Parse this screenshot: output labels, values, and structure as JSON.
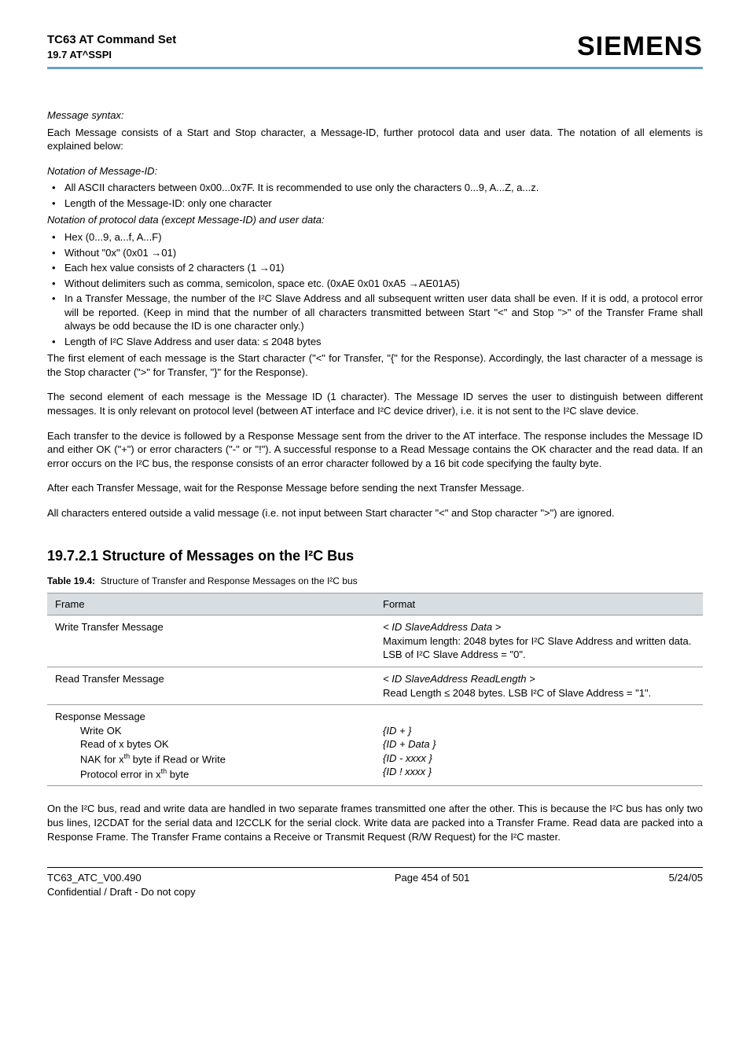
{
  "header": {
    "title": "TC63 AT Command Set",
    "sub": "19.7 AT^SSPI",
    "brand": "SIEMENS"
  },
  "intro": {
    "msgSyntaxLabel": "Message syntax:",
    "msgSyntaxText": "Each Message consists of a Start and Stop character, a Message-ID, further protocol data and user data. The notation of all elements is explained below:",
    "notationMsgIdLabel": "Notation of Message-ID:",
    "msgIdBullets": [
      "All ASCII characters between 0x00...0x7F. It is recommended to use only the characters 0...9, A...Z, a...z.",
      "Length of the Message-ID: only one character"
    ],
    "notationProtoLabel": "Notation of protocol data (except Message-ID) and user data:",
    "protoBullets": [
      "Hex (0...9, a...f, A...F)",
      "Without \"0x\" (0x01 →01)",
      "Each hex value consists of 2 characters (1 →01)",
      "Without delimiters such as comma, semicolon, space etc. (0xAE 0x01 0xA5 →AE01A5)",
      "In a Transfer Message, the number of the I²C Slave Address and all subsequent written user data shall be even. If it is odd, a protocol error will be reported. (Keep in mind that the number of all characters transmitted between Start \"<\" and Stop \">\" of the Transfer Frame shall always be odd because the ID is one character only.)",
      "Length of I²C Slave Address and user data: ≤ 2048 bytes"
    ],
    "p1": "The first element of each message is the Start character (\"<\" for Transfer, \"{\" for the Response). Accordingly, the last character of a message is the Stop character (\">\" for Transfer, \"}\" for the Response).",
    "p2": "The second element of each message is the Message ID (1 character). The Message ID serves the user to distinguish between different messages. It is only relevant on protocol level (between AT interface and I²C device driver), i.e. it is not sent to the I²C slave device.",
    "p3": "Each transfer to the device is followed by a Response Message sent from the driver to the AT interface. The response includes the Message ID and either OK (\"+\") or error characters (\"-\" or \"!\"). A successful response to a Read Message contains the OK character and the read data. If an error occurs on the I²C bus, the response consists of an error character followed by a 16 bit code specifying the faulty byte.",
    "p4": "After each Transfer Message, wait for the Response Message before sending the next Transfer Message.",
    "p5": "All characters entered outside a valid message (i.e. not input between Start character \"<\" and Stop character \">\") are ignored."
  },
  "section": {
    "heading": "19.7.2.1 Structure of Messages on the I²C Bus",
    "tableCaptionBold": "Table 19.4:",
    "tableCaptionRest": "Structure of Transfer and Response Messages on the I²C bus",
    "th1": "Frame",
    "th2": "Format",
    "row1c1": "Write Transfer Message",
    "row1c2_l1": "< ID SlaveAddress Data >",
    "row1c2_l2": "Maximum length: 2048 bytes for I²C Slave Address and written data. LSB of I²C Slave Address = \"0\".",
    "row2c1": "Read Transfer Message",
    "row2c2_l1": "< ID SlaveAddress ReadLength >",
    "row2c2_l2": "Read Length ≤ 2048 bytes. LSB I²C of Slave Address = \"1\".",
    "row3c1_l1": "Response Message",
    "row3c1_l2": "Write OK",
    "row3c1_l3": "Read of x bytes OK",
    "row3c1_l4a": "NAK for x",
    "row3c1_l4b": " byte if Read or Write",
    "row3c1_l5a": "Protocol error in x",
    "row3c1_l5b": " byte",
    "row3c2_l1": "{ID + }",
    "row3c2_l2": "{ID + Data }",
    "row3c2_l3": "{ID - xxxx }",
    "row3c2_l4": "{ID ! xxxx }",
    "afterTable": "On the I²C bus, read and write data are handled in two separate frames transmitted one after the other. This is because the I²C bus has only two bus lines, I2CDAT for the serial data and I2CCLK for the serial clock. Write data are packed into a Transfer Frame. Read data are packed into a Response Frame. The Transfer Frame contains a Receive or Transmit Request (R/W Request) for the I²C master."
  },
  "footer": {
    "leftTop": "TC63_ATC_V00.490",
    "leftBottom": "Confidential / Draft - Do not copy",
    "center": "Page 454 of 501",
    "right": "5/24/05"
  }
}
